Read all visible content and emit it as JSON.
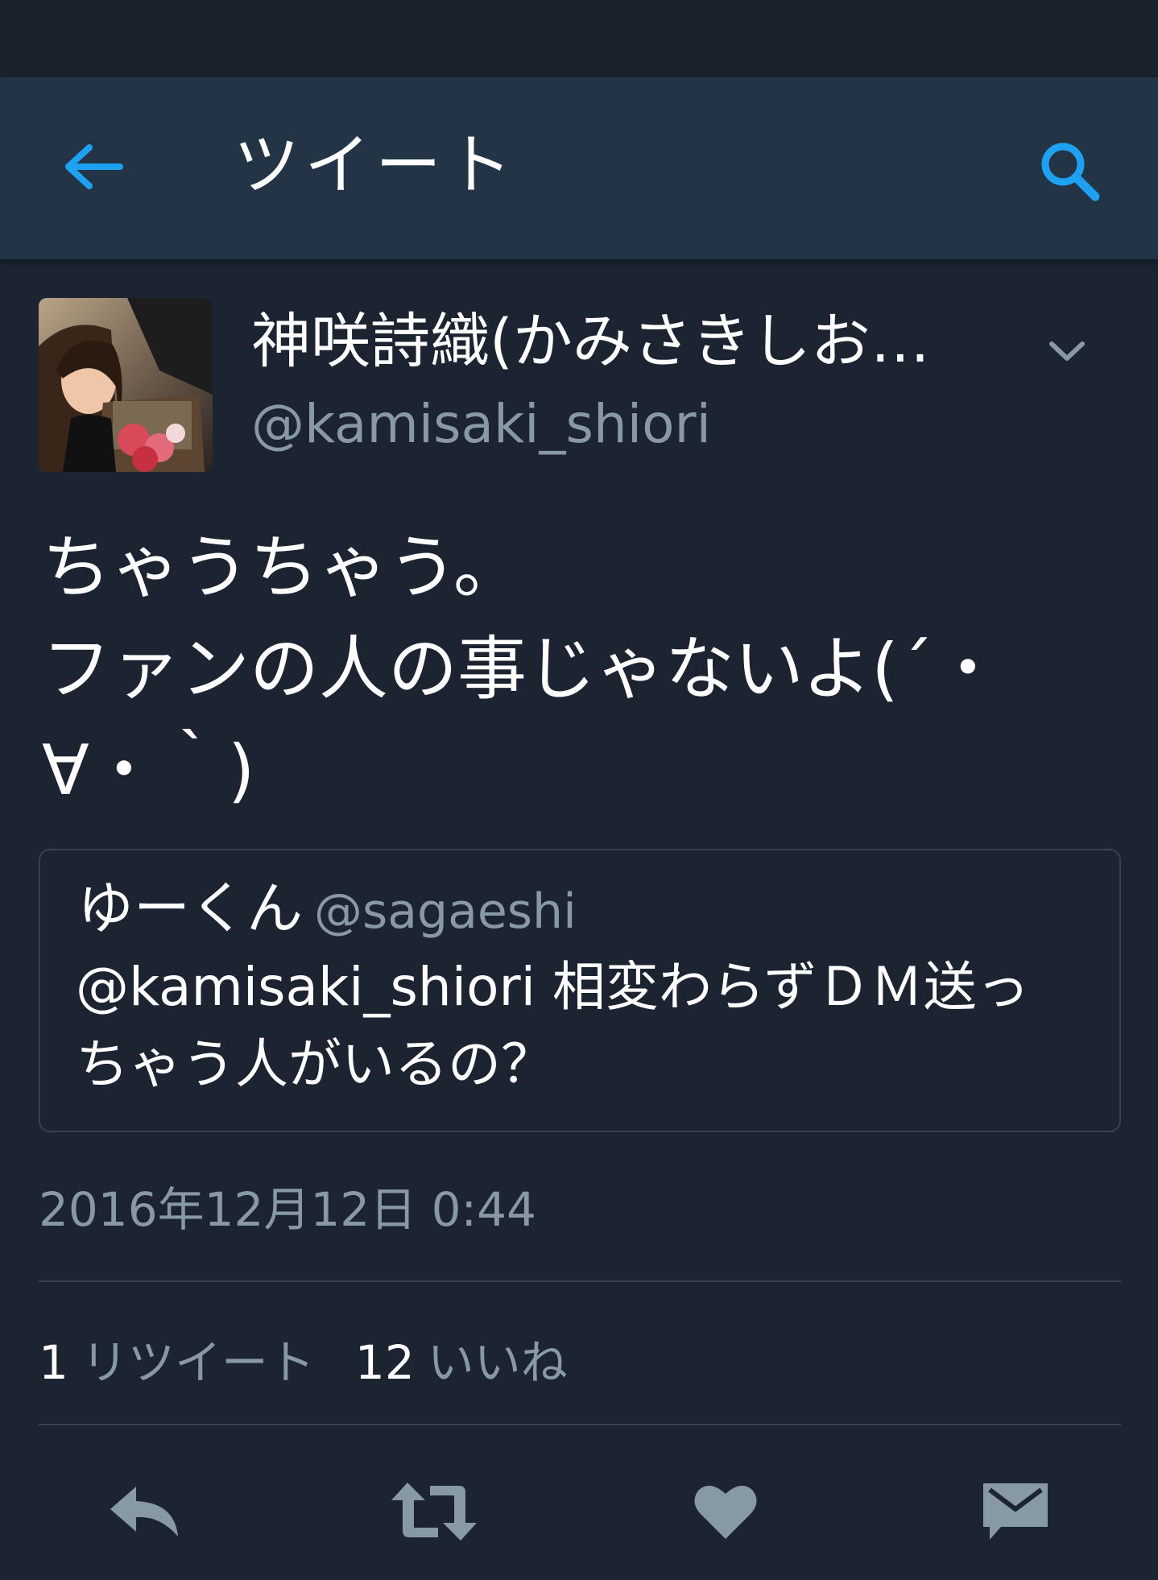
{
  "header": {
    "title": "ツイート",
    "back_icon": "arrow-left-icon",
    "search_icon": "search-icon"
  },
  "tweet": {
    "author_name": "神咲詩織(かみさきしお…",
    "author_handle": "@kamisaki_shiori",
    "text_lines": [
      "ちゃうちゃう。",
      "ファンの人の事じゃないよ(´・",
      "∀・｀)"
    ],
    "quoted": {
      "name": "ゆーくん",
      "handle": "@sagaeshi",
      "text_lines": [
        "@kamisaki_shiori 相変わらずＤＭ送っ",
        "ちゃう人がいるの？"
      ]
    },
    "timestamp": "2016年12月12日 0:44",
    "stats": {
      "retweet_count": "1",
      "retweet_label": "リツイート",
      "like_count": "12",
      "like_label": "いいね"
    }
  },
  "actions": [
    "reply-icon",
    "retweet-icon",
    "heart-icon",
    "direct-message-icon"
  ],
  "colors": {
    "background": "#1b2430",
    "app_bar": "#243447",
    "accent": "#1da1f2",
    "secondary_text": "#8899a6",
    "divider": "#38444d",
    "action_icon": "#8899a6"
  }
}
